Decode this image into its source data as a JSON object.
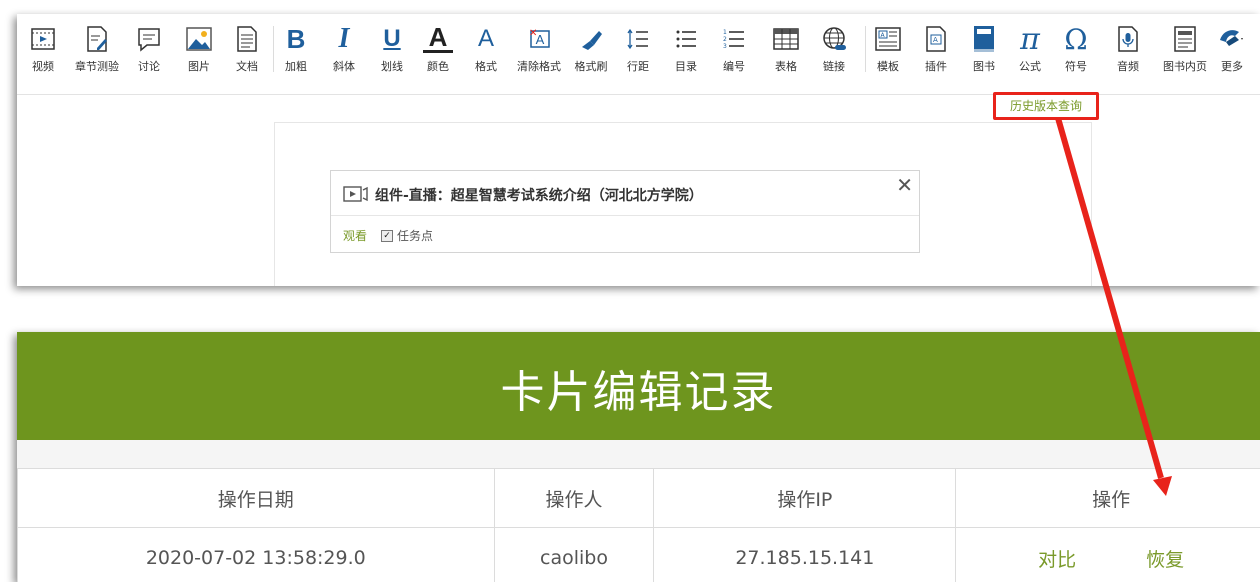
{
  "toolbar": {
    "items": [
      {
        "label": "视频",
        "icon": "video-icon"
      },
      {
        "label": "章节测验",
        "icon": "quiz-icon"
      },
      {
        "label": "讨论",
        "icon": "discussion-icon"
      },
      {
        "label": "图片",
        "icon": "image-icon"
      },
      {
        "label": "文档",
        "icon": "document-icon"
      },
      {
        "label": "加粗",
        "icon": "bold-icon"
      },
      {
        "label": "斜体",
        "icon": "italic-icon"
      },
      {
        "label": "划线",
        "icon": "underline-icon"
      },
      {
        "label": "颜色",
        "icon": "font-color-icon"
      },
      {
        "label": "格式",
        "icon": "font-format-icon"
      },
      {
        "label": "清除格式",
        "icon": "clear-format-icon"
      },
      {
        "label": "格式刷",
        "icon": "format-painter-icon"
      },
      {
        "label": "行距",
        "icon": "line-spacing-icon"
      },
      {
        "label": "目录",
        "icon": "toc-icon"
      },
      {
        "label": "编号",
        "icon": "numbered-list-icon"
      },
      {
        "label": "表格",
        "icon": "table-icon"
      },
      {
        "label": "链接",
        "icon": "link-icon"
      },
      {
        "label": "模板",
        "icon": "template-icon"
      },
      {
        "label": "插件",
        "icon": "plugin-icon"
      },
      {
        "label": "图书",
        "icon": "book-icon"
      },
      {
        "label": "公式",
        "icon": "pi-icon",
        "glyph": "π"
      },
      {
        "label": "符号",
        "icon": "omega-icon",
        "glyph": "Ω"
      },
      {
        "label": "音频",
        "icon": "audio-icon"
      },
      {
        "label": "图书内页",
        "icon": "book-page-icon"
      },
      {
        "label": "更多",
        "icon": "more-icon"
      }
    ],
    "glyphs": {
      "bold": "B",
      "italic": "I",
      "underline": "U",
      "color": "A",
      "format": "A",
      "clear": "A"
    }
  },
  "history_link": "历史版本查询",
  "component": {
    "title": "组件-直播：超星智慧考试系统介绍（河北北方学院）",
    "close": "✕",
    "watch": "观看",
    "task": "任务点",
    "task_checked": true
  },
  "record": {
    "title": "卡片编辑记录",
    "columns": [
      "操作日期",
      "操作人",
      "操作IP",
      "操作"
    ],
    "rows": [
      {
        "date": "2020-07-02 13:58:29.0",
        "user": "caolibo",
        "ip": "27.185.15.141",
        "actions": [
          "对比",
          "恢复"
        ]
      }
    ]
  },
  "colors": {
    "accent_green": "#6e951e",
    "link_green": "#7a9a2a",
    "highlight_red": "#e8231b",
    "icon_blue": "#1f5f9c"
  }
}
